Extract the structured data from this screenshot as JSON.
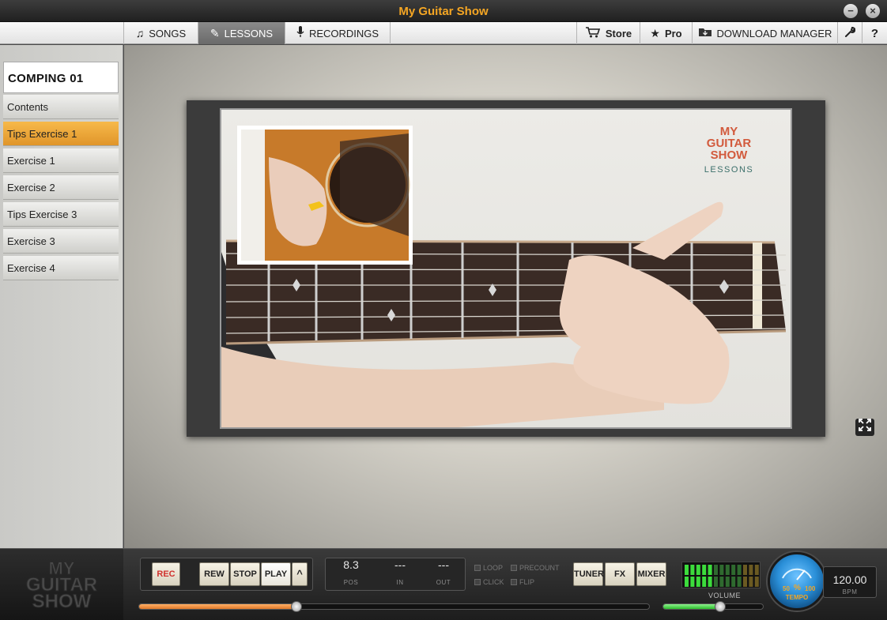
{
  "window": {
    "title": "My Guitar Show",
    "minimize": "−",
    "close": "×"
  },
  "nav": {
    "tabs": [
      {
        "label": "SONGS",
        "icon": "music-note-icon",
        "active": false
      },
      {
        "label": "LESSONS",
        "icon": "pencil-icon",
        "active": true
      },
      {
        "label": "RECORDINGS",
        "icon": "microphone-icon",
        "active": false
      }
    ],
    "store_label": "Store",
    "pro_label": "Pro",
    "download_label": "DOWNLOAD MANAGER",
    "help_label": "?"
  },
  "sidebar": {
    "lesson_title": "COMPING 01",
    "items": [
      {
        "label": "Contents",
        "active": false
      },
      {
        "label": "Tips Exercise 1",
        "active": true
      },
      {
        "label": "Exercise 1",
        "active": false
      },
      {
        "label": "Exercise 2",
        "active": false
      },
      {
        "label": "Tips Exercise 3",
        "active": false
      },
      {
        "label": "Exercise 3",
        "active": false
      },
      {
        "label": "Exercise 4",
        "active": false
      }
    ]
  },
  "video": {
    "logo_line1": "MY",
    "logo_line2": "GUITAR",
    "logo_line3": "SHOW",
    "logo_line4": "LESSONS"
  },
  "brand": {
    "line1": "MY",
    "line2": "GUITAR",
    "line3": "SHOW"
  },
  "transport": {
    "rec": "REC",
    "rew": "REW",
    "stop": "STOP",
    "play": "PLAY",
    "up": "^",
    "pos_value": "8.3",
    "pos_label": "POS",
    "in_value": "---",
    "in_label": "IN",
    "out_value": "---",
    "out_label": "OUT",
    "loop": "LOOP",
    "precount": "PRECOUNT",
    "click": "CLICK",
    "flip": "FLIP",
    "tuner": "TUNER",
    "fx": "FX",
    "mixer": "MIXER",
    "volume_label": "VOLUME",
    "tempo_label": "TEMPO",
    "tempo_min": "50",
    "tempo_pct": "%",
    "tempo_max": "100",
    "bpm_value": "120.00",
    "bpm_label": "BPM",
    "progress": 0.31,
    "volume_level": 0.58
  },
  "colors": {
    "accent": "#f5a623",
    "active_item": "#f0a83a",
    "rec": "#d0312d",
    "meter_green": "#3cdc3c",
    "dial": "#2a8fd8"
  }
}
